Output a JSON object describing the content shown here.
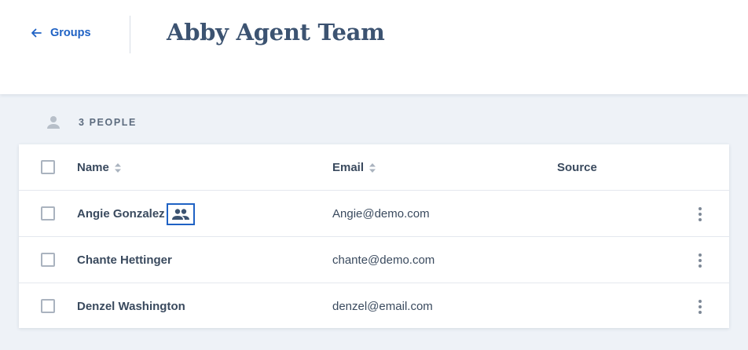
{
  "header": {
    "back_label": "Groups",
    "title": "Abby Agent Team"
  },
  "summary": {
    "count_label": "3 PEOPLE"
  },
  "table": {
    "columns": {
      "name": "Name",
      "email": "Email",
      "source": "Source"
    },
    "rows": [
      {
        "name": "Angie Gonzalez",
        "email": "Angie@demo.com",
        "source": "",
        "has_group_badge": true
      },
      {
        "name": "Chante Hettinger",
        "email": "chante@demo.com",
        "source": "",
        "has_group_badge": false
      },
      {
        "name": "Denzel Washington",
        "email": "denzel@email.com",
        "source": "",
        "has_group_badge": false
      }
    ]
  },
  "icons": {
    "back": "arrow-left-icon",
    "person": "person-icon",
    "sort": "sort-icon",
    "group": "group-icon",
    "more": "more-vertical-icon"
  },
  "colors": {
    "accent": "#1f62c4",
    "title": "#3c5371",
    "text": "#3a4a5e",
    "background": "#eef2f7"
  }
}
